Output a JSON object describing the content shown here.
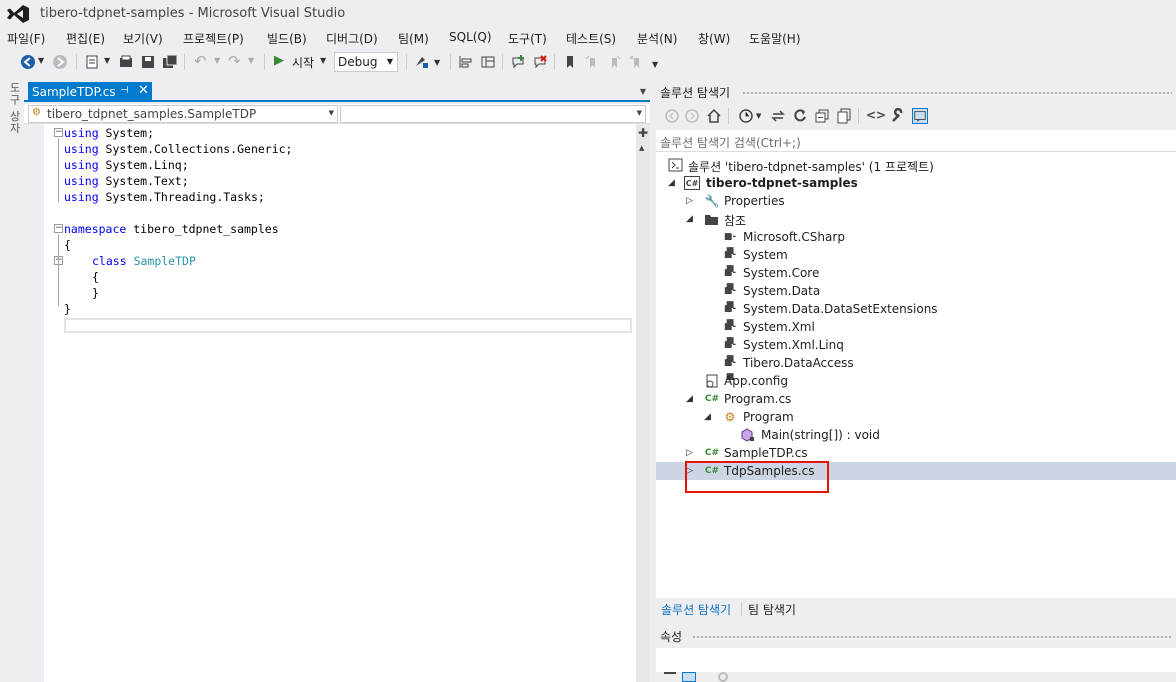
{
  "window": {
    "title": "tibero-tdpnet-samples - Microsoft Visual Studio"
  },
  "menu": [
    "파일(F)",
    "편집(E)",
    "보기(V)",
    "프로젝트(P)",
    "빌드(B)",
    "디버그(D)",
    "팀(M)",
    "SQL(Q)",
    "도구(T)",
    "테스트(S)",
    "분석(N)",
    "창(W)",
    "도움말(H)"
  ],
  "toolbar": {
    "start_label": "시작",
    "config_value": "Debug"
  },
  "left_strip": {
    "toolbox_label": "도구 상자"
  },
  "editor": {
    "tab_label": "SampleTDP.cs",
    "nav_class": "tibero_tdpnet_samples.SampleTDP",
    "nav_member": "",
    "code": {
      "l1_kw": "using",
      "l1_rest": " System;",
      "l2_kw": "using",
      "l2_rest": " System.Collections.Generic;",
      "l3_kw": "using",
      "l3_rest": " System.Linq;",
      "l4_kw": "using",
      "l4_rest": " System.Text;",
      "l5_kw": "using",
      "l5_rest": " System.Threading.Tasks;",
      "l7_kw": "namespace",
      "l7_rest": " tibero_tdpnet_samples",
      "l8": "{",
      "l9_kw": "class",
      "l9_type": "SampleTDP",
      "l10": "{",
      "l11": "}",
      "l12": "}"
    }
  },
  "solution_explorer": {
    "title": "솔루션 탐색기",
    "search_placeholder": "솔루션 탐색기 검색(Ctrl+;)",
    "tree": {
      "solution": "솔루션 'tibero-tdpnet-samples' (1 프로젝트)",
      "project": "tibero-tdpnet-samples",
      "properties": "Properties",
      "references": "참조",
      "refs": [
        "Microsoft.CSharp",
        "System",
        "System.Core",
        "System.Data",
        "System.Data.DataSetExtensions",
        "System.Xml",
        "System.Xml.Linq",
        "Tibero.DataAccess"
      ],
      "app_config": "App.config",
      "program_cs": "Program.cs",
      "program_class": "Program",
      "main_method": "Main(string[]) : void",
      "sample_tdp": "SampleTDP.cs",
      "tdp_samples": "TdpSamples.cs"
    },
    "bottom_tabs": [
      "솔루션 탐색기",
      "팀 탐색기"
    ]
  },
  "properties": {
    "title": "속성"
  },
  "colors": {
    "accent": "#007acc",
    "highlight_box": "#e51400",
    "selected_row": "#ccd5e3"
  }
}
